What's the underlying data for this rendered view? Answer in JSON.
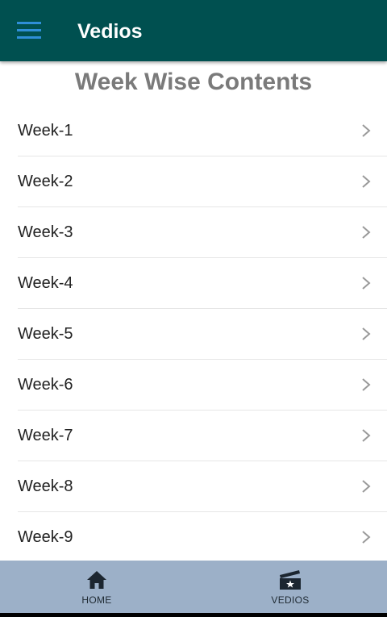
{
  "app_bar": {
    "title": "Vedios",
    "menu_icon": "hamburger-menu-icon",
    "background": "#005050",
    "menu_icon_color": "#2f8fd8"
  },
  "page": {
    "heading": "Week Wise Contents"
  },
  "weeks": [
    {
      "label": "Week-1"
    },
    {
      "label": "Week-2"
    },
    {
      "label": "Week-3"
    },
    {
      "label": "Week-4"
    },
    {
      "label": "Week-5"
    },
    {
      "label": "Week-6"
    },
    {
      "label": "Week-7"
    },
    {
      "label": "Week-8"
    },
    {
      "label": "Week-9"
    }
  ],
  "bottom_nav": {
    "background": "#9cb0c8",
    "tabs": [
      {
        "label": "HOME",
        "icon": "home-icon"
      },
      {
        "label": "VEDIOS",
        "icon": "video-clapper-icon"
      }
    ]
  }
}
